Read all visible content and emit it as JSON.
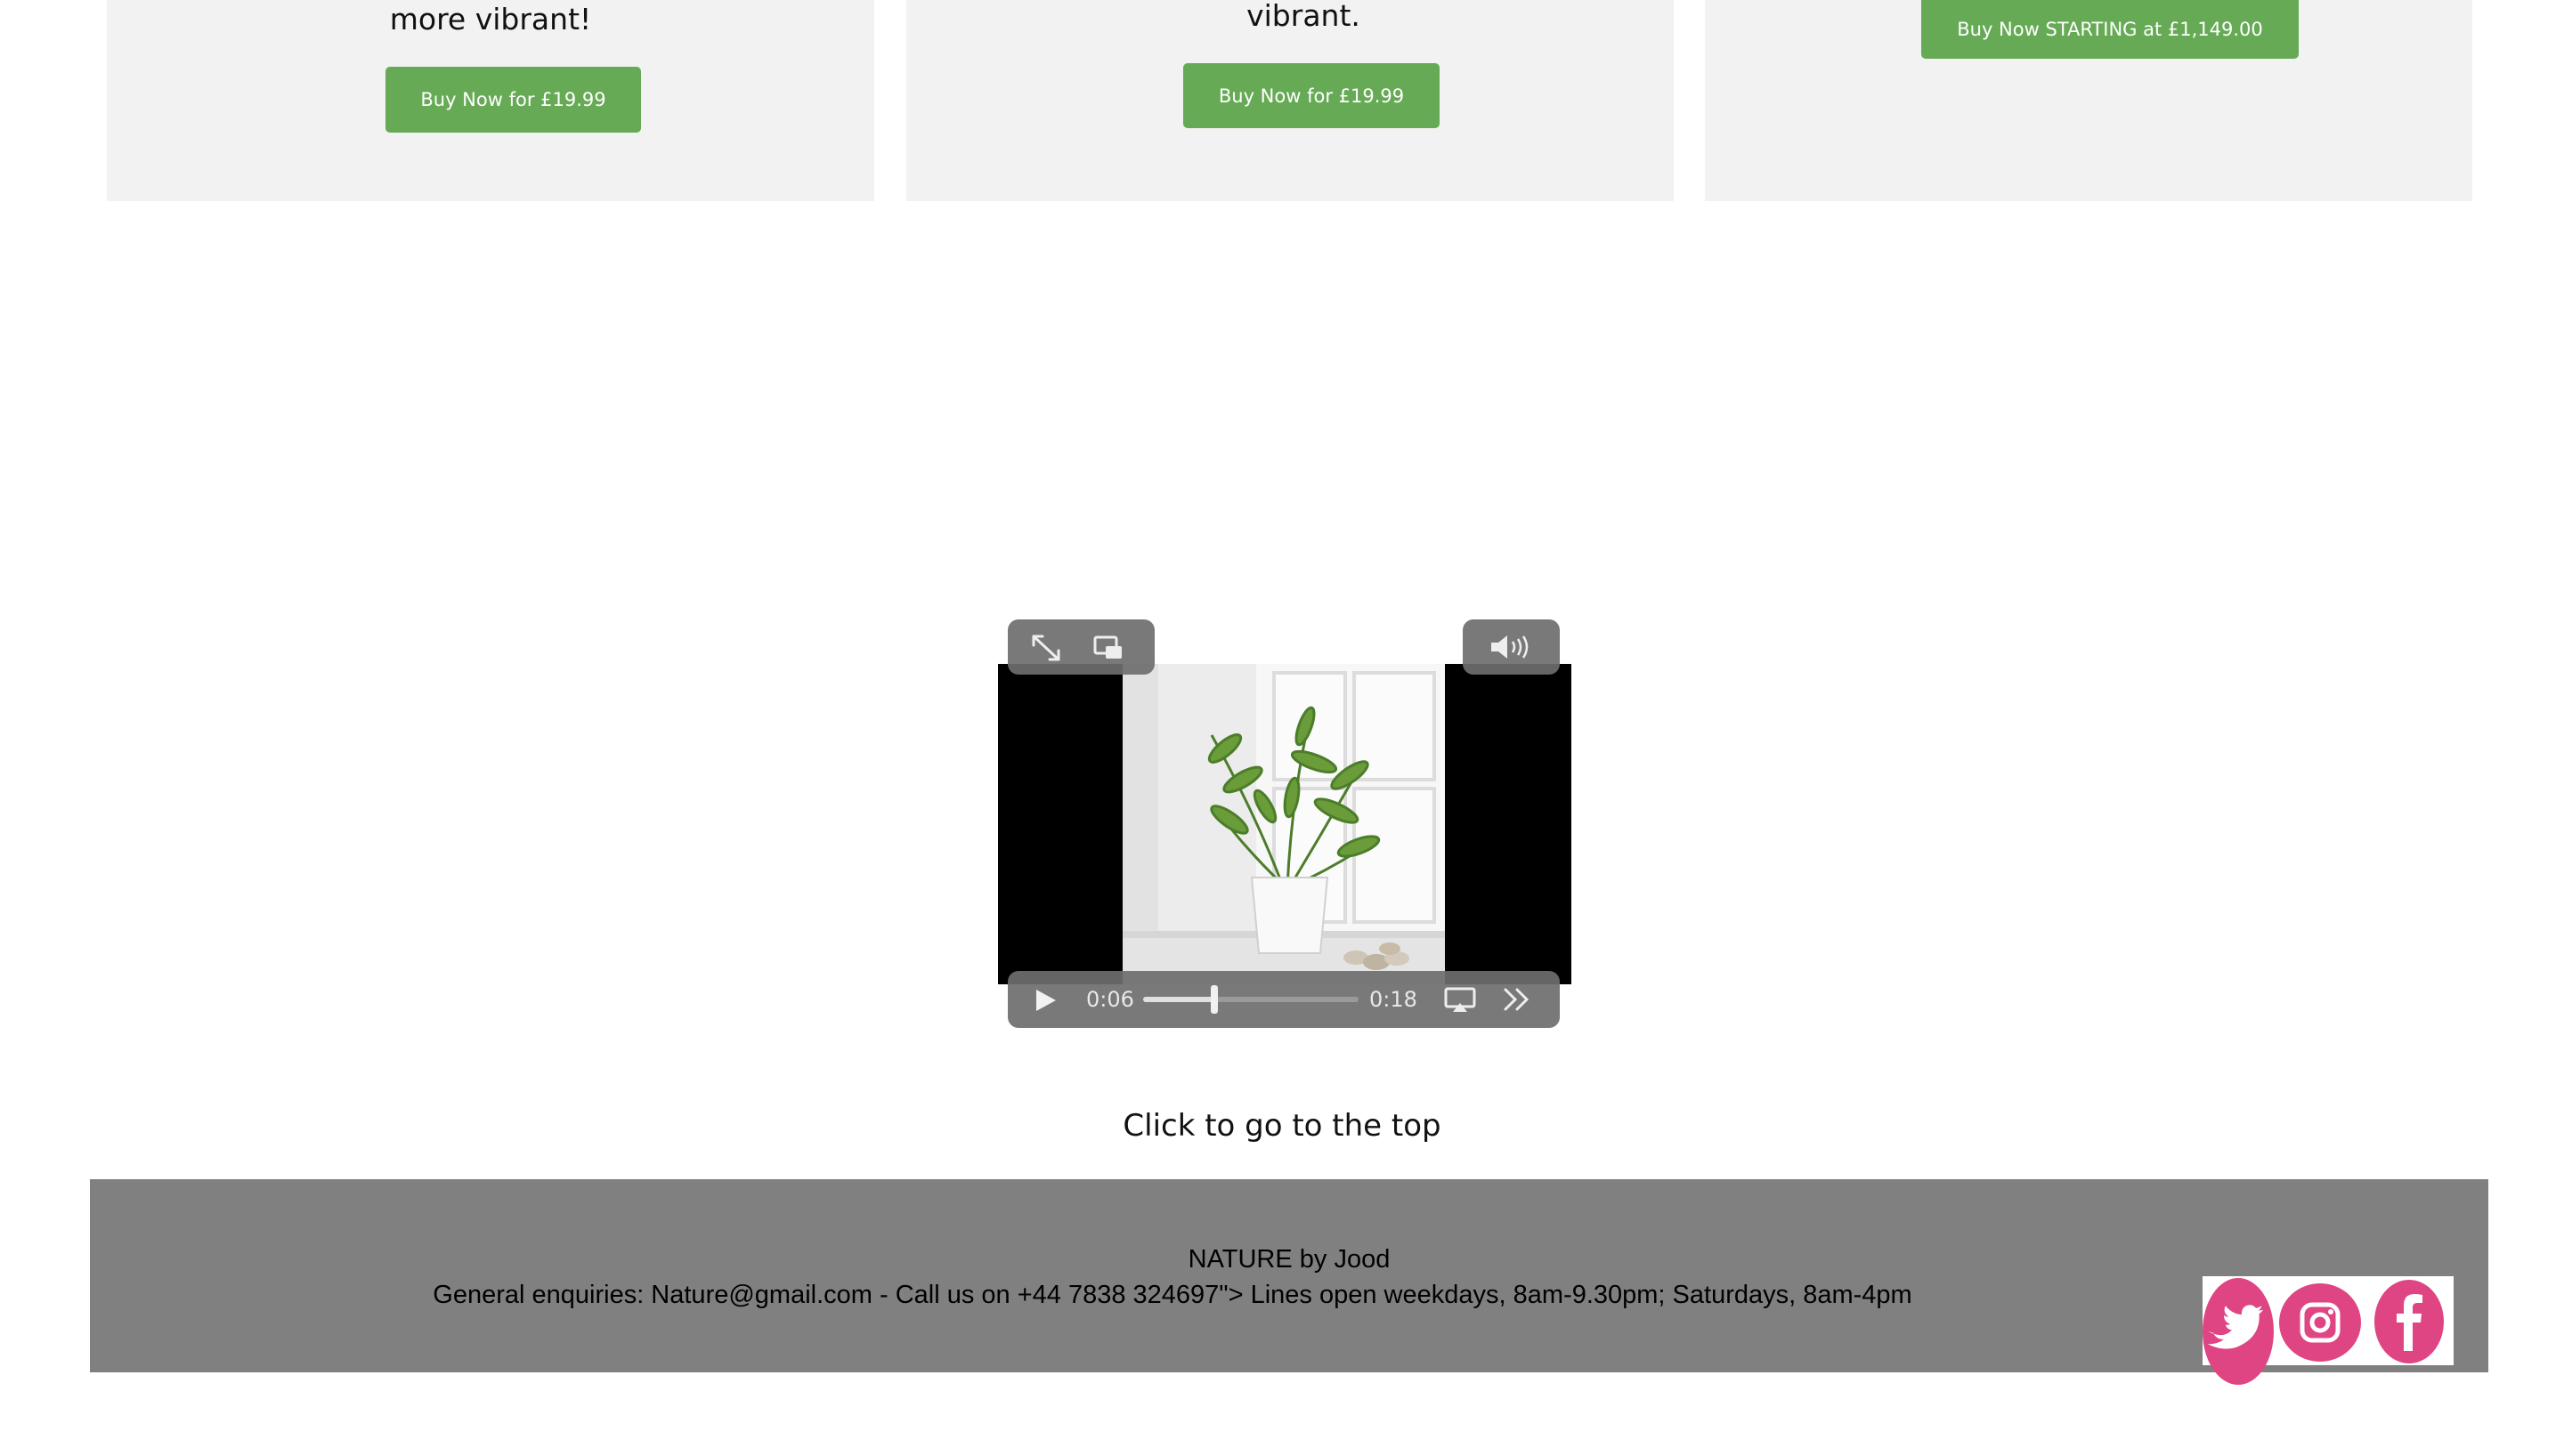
{
  "products": [
    {
      "text_partial": "more vibrant!",
      "button_label": "Buy Now for £19.99"
    },
    {
      "text_partial": "vibrant.",
      "button_label": "Buy Now for £19.99"
    },
    {
      "button_label": "Buy Now STARTING at £1,149.00"
    }
  ],
  "video": {
    "current_time": "0:06",
    "duration": "0:18",
    "progress_fraction": 0.33,
    "controls": [
      "fullscreen-icon",
      "picture-in-picture-icon",
      "volume-icon",
      "play-icon",
      "airplay-icon",
      "skip-forward-icon"
    ]
  },
  "back_to_top": "Click to go to the top",
  "footer": {
    "brand": "NATURE by Jood",
    "contact": "General enquiries: Nature@gmail.com - Call us on +44 7838 324697\"> Lines open weekdays, 8am-9.30pm; Saturdays, 8am-4pm"
  },
  "social": [
    "twitter-icon",
    "instagram-icon",
    "facebook-icon"
  ],
  "colors": {
    "button_green": "#66aa55",
    "card_bg": "#f2f2f2",
    "footer_bg": "#808080",
    "social_pink": "#df4583"
  }
}
